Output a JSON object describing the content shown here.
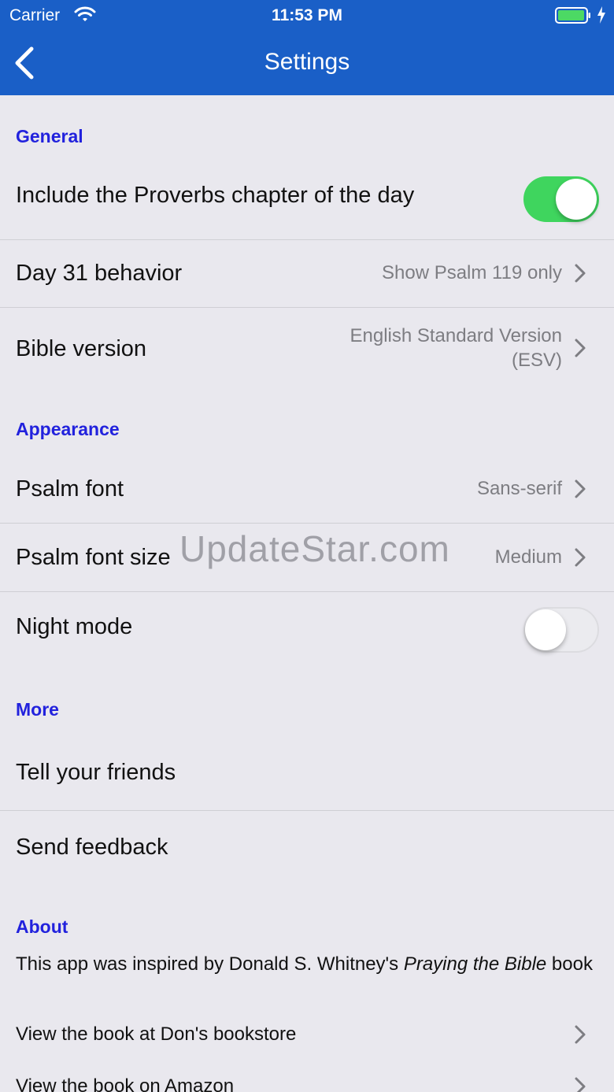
{
  "status_bar": {
    "carrier": "Carrier",
    "time": "11:53 PM",
    "wifi_icon": "wifi-icon",
    "battery_icon": "battery-charging-icon"
  },
  "nav": {
    "title": "Settings",
    "back_icon": "chevron-left-icon"
  },
  "colors": {
    "nav_bar": "#1a5fc7",
    "section_header": "#2222dd",
    "toggle_on": "#3fd55e",
    "background": "#e9e8ee"
  },
  "sections": {
    "general": {
      "header": "General",
      "proverbs_label": "Include the Proverbs chapter of the day",
      "proverbs_enabled": true,
      "day31_label": "Day 31 behavior",
      "day31_value": "Show Psalm 119 only",
      "bible_label": "Bible version",
      "bible_value_line1": "English Standard Version",
      "bible_value_line2": "(ESV)"
    },
    "appearance": {
      "header": "Appearance",
      "psalm_font_label": "Psalm font",
      "psalm_font_value": "Sans-serif",
      "psalm_font_size_label": "Psalm font size",
      "psalm_font_size_value": "Medium",
      "night_mode_label": "Night mode",
      "night_mode_enabled": false
    },
    "more": {
      "header": "More",
      "tell_friends_label": "Tell your friends",
      "send_feedback_label": "Send feedback"
    },
    "about": {
      "header": "About",
      "text_prefix": "This app was inspired by Donald S. Whitney's ",
      "text_italic": "Praying the Bible",
      "text_suffix": " book",
      "bookstore_link": "View the book at Don's bookstore",
      "amazon_link": "View the book on Amazon"
    }
  },
  "watermark": "UpdateStar.com"
}
